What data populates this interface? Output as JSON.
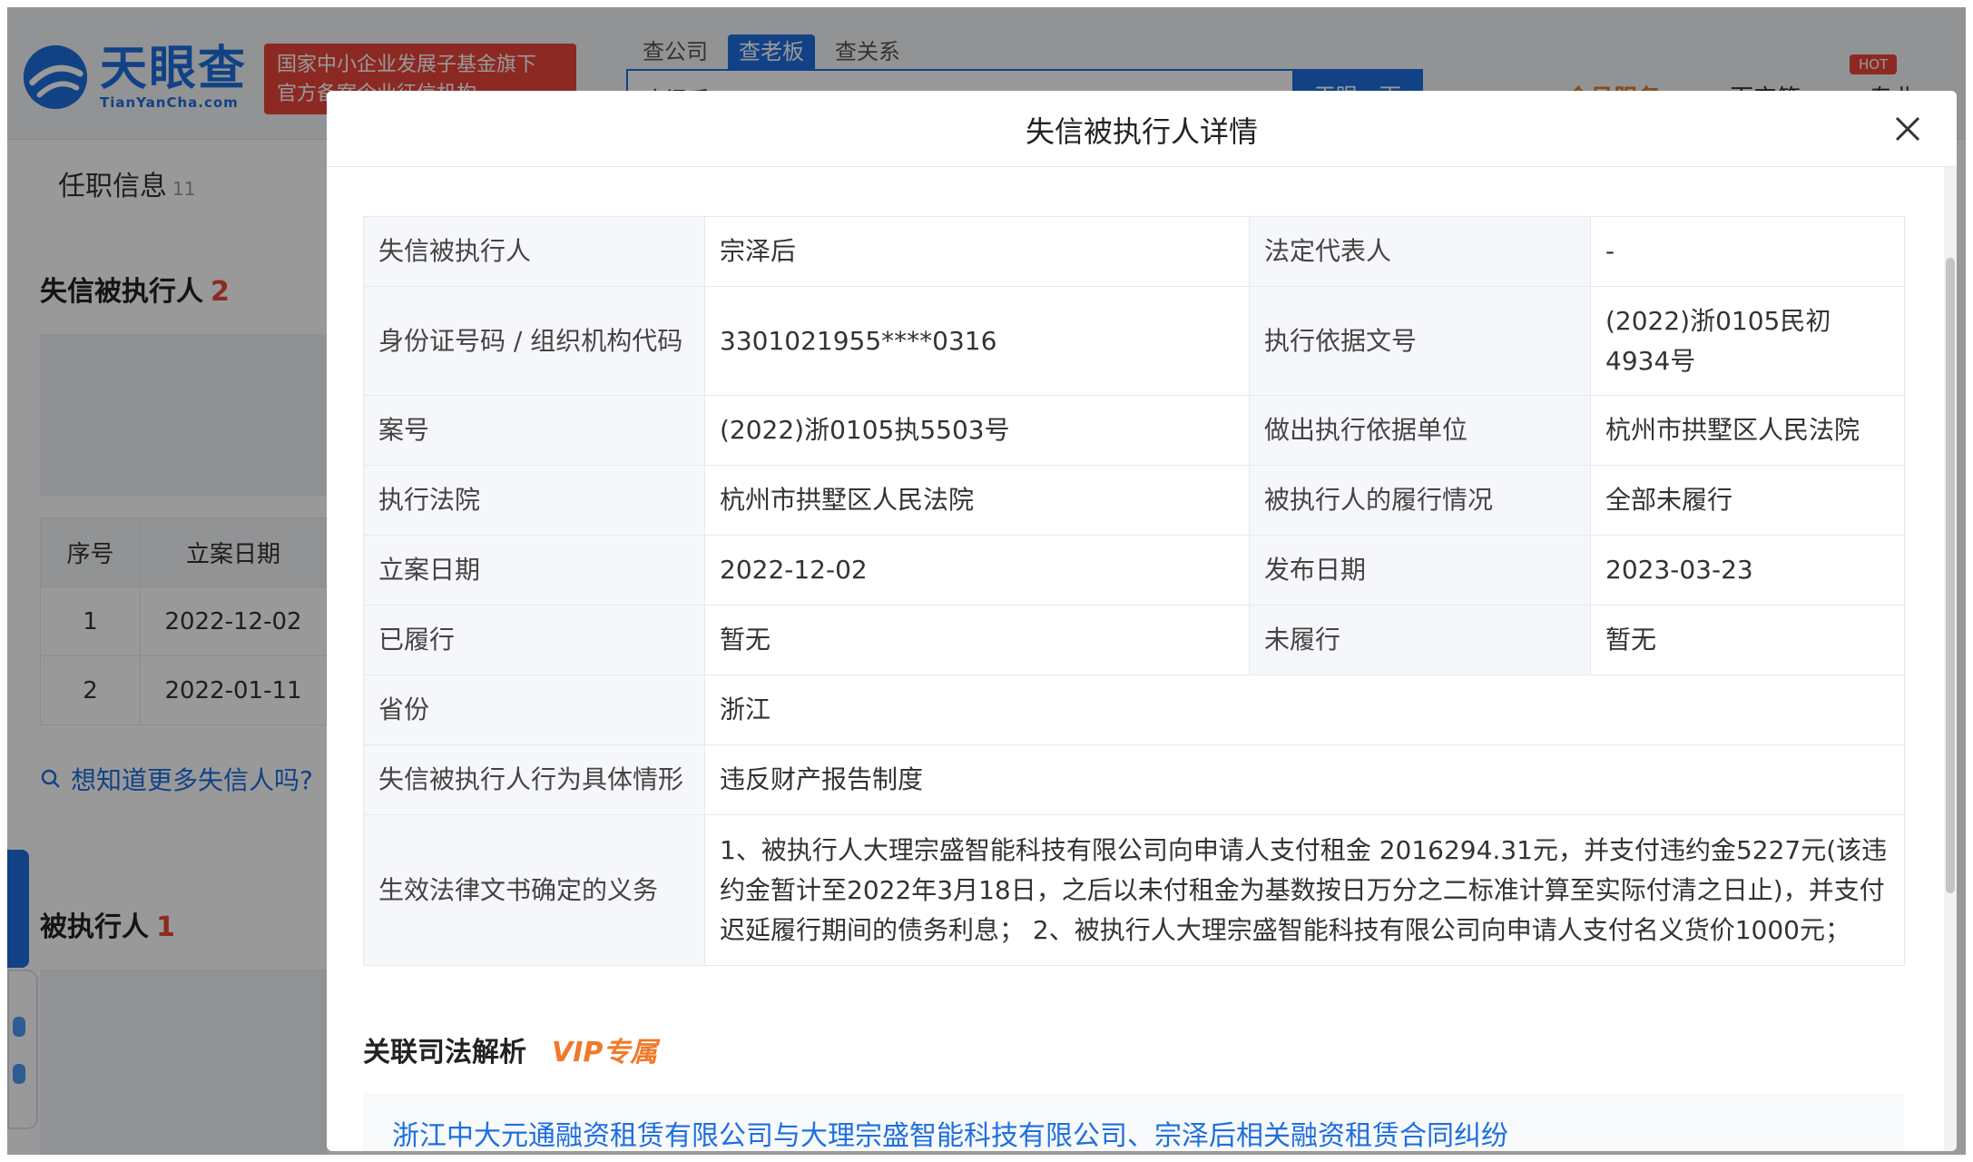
{
  "brand": {
    "name_cn": "天眼查",
    "name_en": "TianYanCha.com",
    "gov_badge_line1": "国家中小企业发展子基金旗下",
    "gov_badge_line2": "官方备案企业征信机构"
  },
  "search": {
    "tabs": [
      "查公司",
      "查老板",
      "查关系"
    ],
    "active_tab": "查老板",
    "value": "宗泽后",
    "button": "天眼一下"
  },
  "nav": {
    "hot": "HOT",
    "vip": "会员服务 ▾",
    "baibao": "百宝箱 ▾",
    "pro": "专业"
  },
  "left": {
    "tab_label": "任职信息",
    "tab_count": "11",
    "section1_title": "失信被执行人",
    "section1_count": "2",
    "table_headers": [
      "序号",
      "立案日期"
    ],
    "rows": [
      {
        "no": "1",
        "date": "2022-12-02"
      },
      {
        "no": "2",
        "date": "2022-01-11"
      }
    ],
    "more_link": "想知道更多失信人吗?",
    "section2_title": "被执行人",
    "section2_count": "1"
  },
  "modal": {
    "title": "失信被执行人详情",
    "rows": [
      {
        "l1": "失信被执行人",
        "v1": "宗泽后",
        "l2": "法定代表人",
        "v2": "-"
      },
      {
        "l1": "身份证号码 / 组织机构代码",
        "v1": "3301021955****0316",
        "l2": "执行依据文号",
        "v2": "(2022)浙0105民初4934号"
      },
      {
        "l1": "案号",
        "v1": "(2022)浙0105执5503号",
        "l2": "做出执行依据单位",
        "v2": "杭州市拱墅区人民法院"
      },
      {
        "l1": "执行法院",
        "v1": "杭州市拱墅区人民法院",
        "l2": "被执行人的履行情况",
        "v2": "全部未履行"
      },
      {
        "l1": "立案日期",
        "v1": "2022-12-02",
        "l2": "发布日期",
        "v2": "2023-03-23"
      },
      {
        "l1": "已履行",
        "v1": "暂无",
        "l2": "未履行",
        "v2": "暂无"
      }
    ],
    "province_label": "省份",
    "province_value": "浙江",
    "behavior_label": "失信被执行人行为具体情形",
    "behavior_value": "违反财产报告制度",
    "duty_label": "生效法律文书确定的义务",
    "duty_value": "1、被执行人大理宗盛智能科技有限公司向申请人支付租金 2016294.31元，并支付违约金5227元(该违约金暂计至2022年3月18日，之后以未付租金为基数按日万分之二标准计算至实际付清之日止)，并支付迟延履行期间的债务利息； 2、被执行人大理宗盛智能科技有限公司向申请人支付名义货价1000元；",
    "assoc_title": "关联司法解析",
    "vip_tag": "VIP专属",
    "assoc_link": "浙江中大元通融资租赁有限公司与大理宗盛智能科技有限公司、宗泽后相关融资租赁合同纠纷"
  },
  "colors": {
    "brand_blue": "#1e6fe0",
    "alert_red": "#e9453b",
    "vip_orange": "#f07a2a"
  }
}
